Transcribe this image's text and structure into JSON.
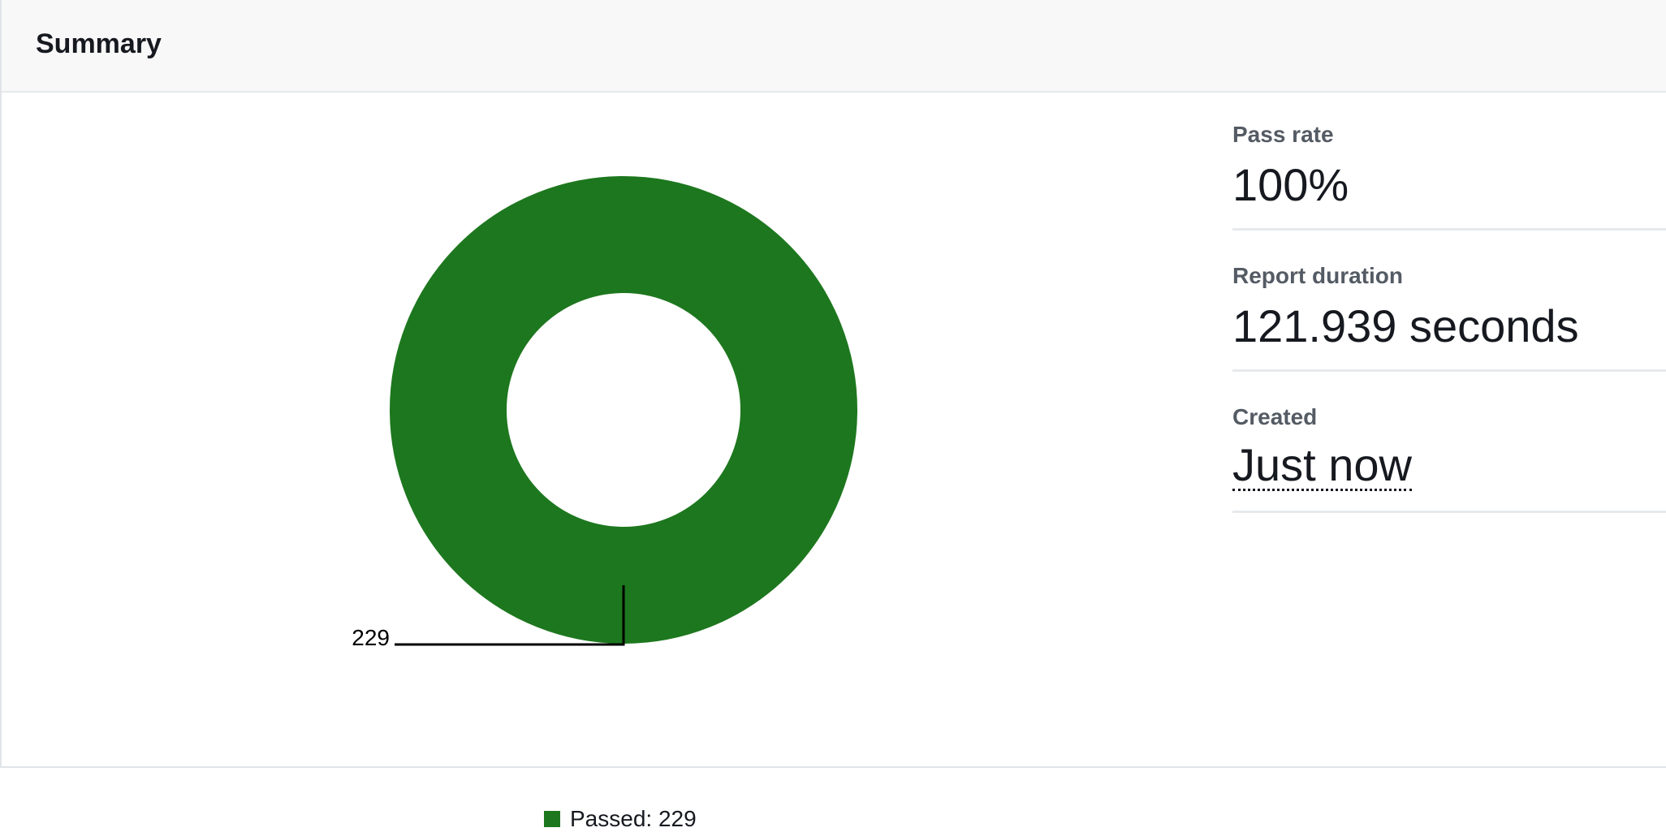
{
  "header": {
    "title": "Summary"
  },
  "chart_data": {
    "type": "pie",
    "categories": [
      "Passed"
    ],
    "values": [
      229
    ],
    "slice_labels": [
      "229"
    ],
    "legend": [
      {
        "label": "Passed: 229",
        "color": "#1d771e"
      }
    ],
    "colors": [
      "#1d771e"
    ],
    "legend_position": "bottom"
  },
  "metrics": {
    "pass_rate": {
      "label": "Pass rate",
      "value": "100%"
    },
    "report_duration": {
      "label": "Report duration",
      "value": "121.939 seconds"
    },
    "created": {
      "label": "Created",
      "value": "Just now"
    }
  }
}
